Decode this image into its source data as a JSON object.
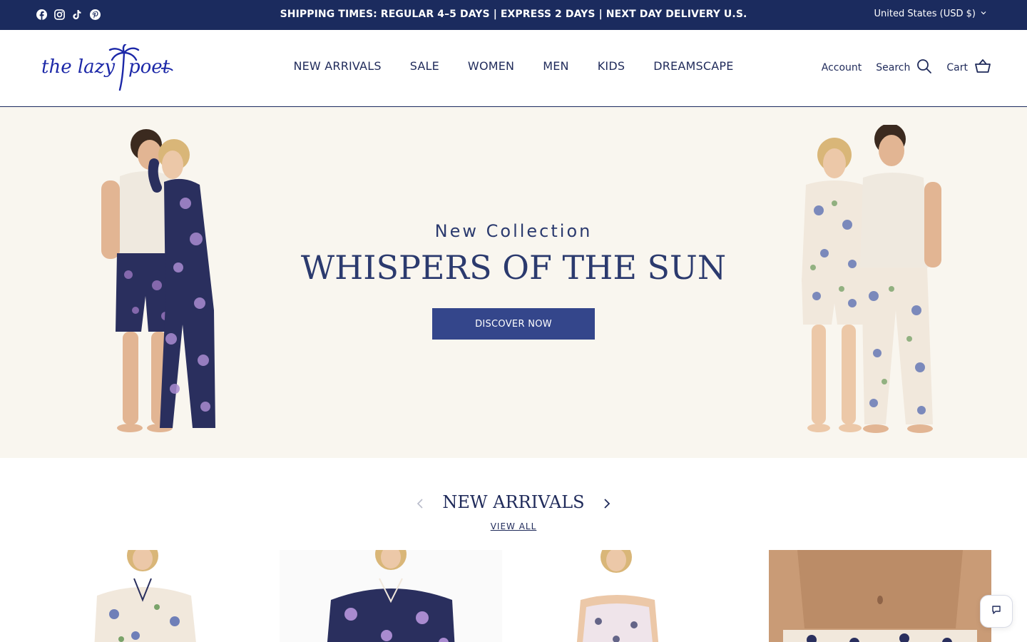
{
  "announcement": {
    "text": "SHIPPING TIMES: REGULAR 4–5 DAYS | EXPRESS 2 DAYS | NEXT DAY DELIVERY U.S.",
    "currency": "United States (USD $)",
    "social_icons": [
      "facebook-icon",
      "instagram-icon",
      "tiktok-icon",
      "pinterest-icon"
    ]
  },
  "header": {
    "logo_text": "the lazy poet",
    "nav": [
      "NEW ARRIVALS",
      "SALE",
      "WOMEN",
      "MEN",
      "KIDS",
      "DREAMSCAPE"
    ],
    "account_label": "Account",
    "search_label": "Search",
    "cart_label": "Cart"
  },
  "hero": {
    "subtitle": "New Collection",
    "title": "WHISPERS OF THE SUN",
    "button_label": "DISCOVER NOW"
  },
  "new_arrivals": {
    "title": "NEW ARRIVALS",
    "view_all_label": "VIEW ALL"
  },
  "colors": {
    "brand_navy": "#1b2b5e",
    "button_blue": "#34468b",
    "hero_bg": "#f9f6ef"
  }
}
